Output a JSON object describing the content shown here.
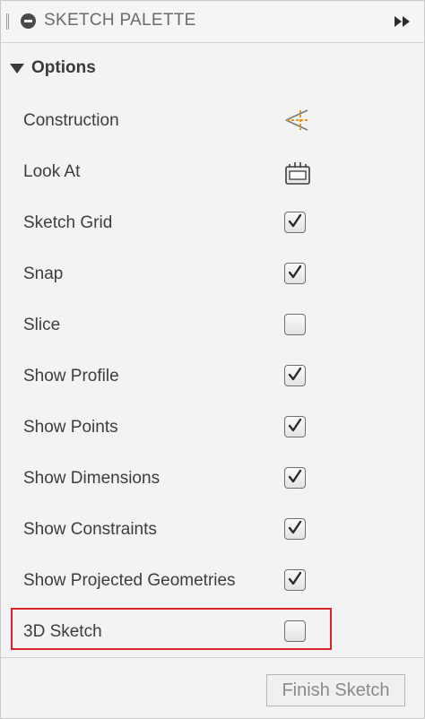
{
  "palette": {
    "title": "SKETCH PALETTE"
  },
  "section": {
    "label": "Options"
  },
  "options": [
    {
      "label": "Construction",
      "control": "construction-icon"
    },
    {
      "label": "Look At",
      "control": "look-at-icon"
    },
    {
      "label": "Sketch Grid",
      "control": "checkbox",
      "checked": true
    },
    {
      "label": "Snap",
      "control": "checkbox",
      "checked": true
    },
    {
      "label": "Slice",
      "control": "checkbox",
      "checked": false
    },
    {
      "label": "Show Profile",
      "control": "checkbox",
      "checked": true
    },
    {
      "label": "Show Points",
      "control": "checkbox",
      "checked": true
    },
    {
      "label": "Show Dimensions",
      "control": "checkbox",
      "checked": true
    },
    {
      "label": "Show Constraints",
      "control": "checkbox",
      "checked": true
    },
    {
      "label": "Show Projected Geometries",
      "control": "checkbox",
      "checked": true
    },
    {
      "label": "3D Sketch",
      "control": "checkbox",
      "checked": false,
      "highlighted": true
    }
  ],
  "footer": {
    "finish_label": "Finish Sketch"
  },
  "colors": {
    "highlight": "#d9232d",
    "construction_icon": "#e8931a"
  }
}
